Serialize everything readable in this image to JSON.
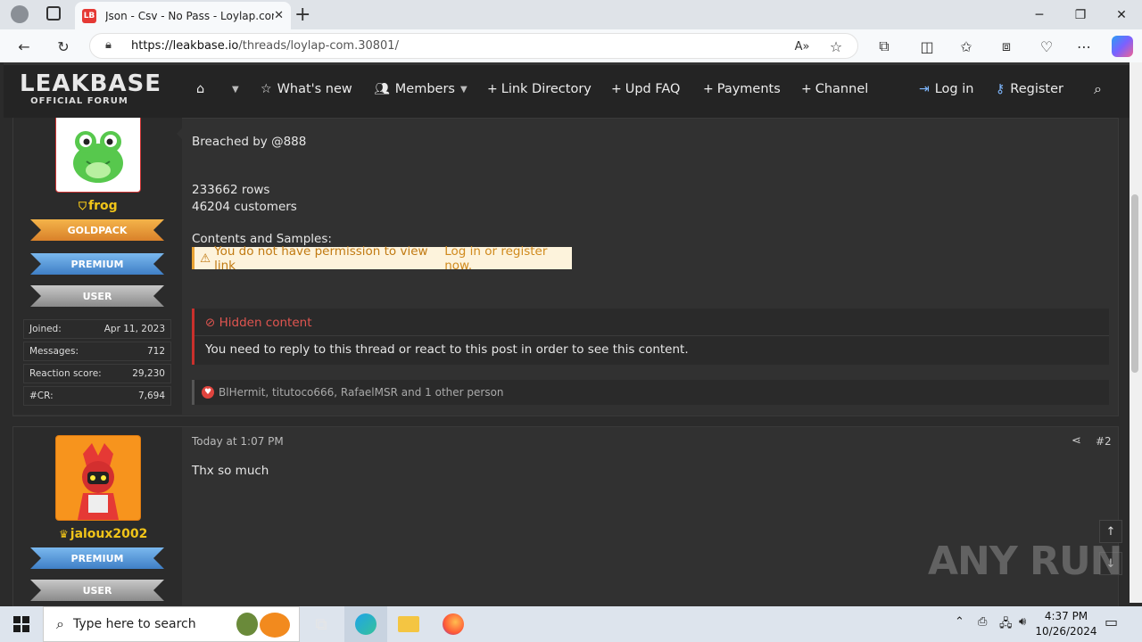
{
  "browser": {
    "tab_title": "Json - Csv - No Pass - Loylap.com",
    "tab_close": "✕",
    "new_tab": "+",
    "url_host": "https://leakbase.io",
    "url_path": "/threads/loylap-com.30801/"
  },
  "window": {
    "minimize": "─",
    "restore": "❐",
    "close": "✕"
  },
  "forum": {
    "logo_main": "LEAKBASE",
    "logo_sub": "OFFICIAL FORUM",
    "nav": {
      "whats_new": "What's new",
      "members": "Members",
      "link_directory": "Link Directory",
      "upd_faq": "Upd FAQ",
      "payments": "Payments",
      "channel": "Channel",
      "log_in": "Log in",
      "register": "Register"
    }
  },
  "post1": {
    "username": "frog",
    "ranks": [
      "GOLDPACK",
      "PREMIUM",
      "USER"
    ],
    "stats": [
      {
        "label": "Joined:",
        "value": "Apr 11, 2023"
      },
      {
        "label": "Messages:",
        "value": "712"
      },
      {
        "label": "Reaction score:",
        "value": "29,230"
      },
      {
        "label": "#CR:",
        "value": "7,694"
      }
    ],
    "line1": "Breached by @888",
    "line2": "233662 rows",
    "line3": "46204 customers",
    "line4": "Contents and Samples:",
    "perm_text": "You do not have permission to view link",
    "perm_link": "Log in or register now.",
    "hidden_title": "Hidden content",
    "hidden_body": "You need to reply to this thread or react to this post in order to see this content.",
    "reactions": "BlHermit, titutoco666, RafaelMSR and 1 other person"
  },
  "post2": {
    "username": "jaloux2002",
    "ranks": [
      "PREMIUM",
      "USER"
    ],
    "time": "Today at 1:07 PM",
    "number": "#2",
    "body": "Thx so much"
  },
  "watermark": "ANY RUN",
  "taskbar": {
    "search_placeholder": "Type here to search",
    "time": "4:37 PM",
    "date": "10/26/2024"
  },
  "colors": {
    "accent_gold": "#f0c419",
    "hidden_red": "#e05550",
    "link_blue": "#7fb8ff"
  }
}
